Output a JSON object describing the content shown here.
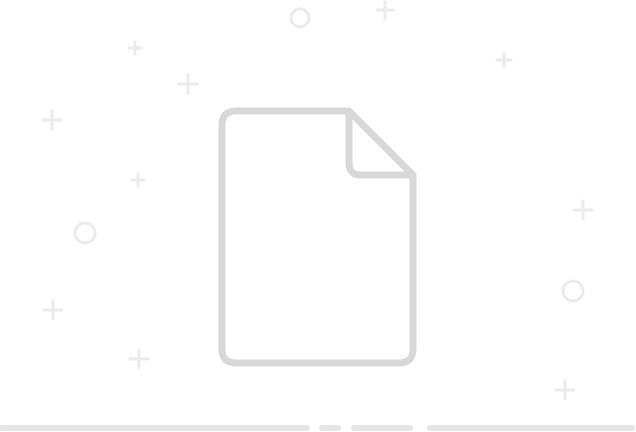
{
  "illustration": {
    "name": "empty-document-illustration",
    "colors": {
      "document_stroke": "#d8d8d8",
      "decoration": "#ebebeb",
      "accent_start": "#3bc8f0",
      "accent_end": "#2ea8ee",
      "ground_line": "#e5e5e5"
    },
    "icons": [
      "document-icon",
      "text-line-icon",
      "plus-sparkle-icon",
      "circle-sparkle-icon"
    ]
  }
}
